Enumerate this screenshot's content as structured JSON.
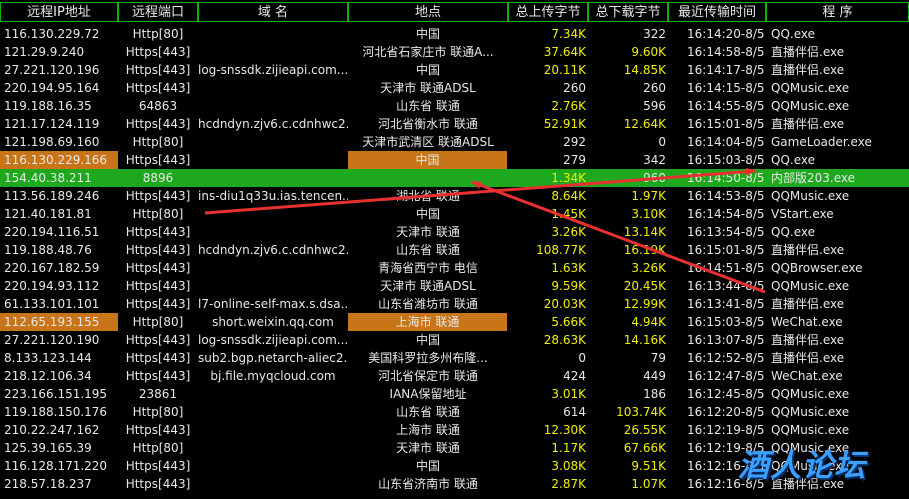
{
  "headers": {
    "ip": "远程IP地址",
    "port": "远程端口",
    "domain": "域  名",
    "location": "地点",
    "upload": "总上传字节",
    "download": "总下载字节",
    "time": "最近传输时间",
    "program": "程  序"
  },
  "colors": {
    "text_default": "#e8e8e8",
    "up_down_normal": "#e8e8e8",
    "up_down_active": "#f0f000",
    "header_border": "#00b400",
    "row_highlight": "#c87418",
    "row_selected": "#1da81d",
    "annotation_arrow": "#e83030",
    "watermark": "#3aa0ff"
  },
  "rows": [
    {
      "ip": "116.130.229.72",
      "port": "Http[80]",
      "domain": "",
      "location": "中国",
      "up": "7.34K",
      "down": "322",
      "time": "16:14:20-8/5",
      "program": "QQ.exe",
      "up_active": true,
      "down_active": false
    },
    {
      "ip": "121.29.9.240",
      "port": "Https[443]",
      "domain": "",
      "location": "河北省石家庄市 联通A...",
      "up": "37.64K",
      "down": "9.60K",
      "time": "16:14:58-8/5",
      "program": "直播伴侣.exe",
      "up_active": true,
      "down_active": true
    },
    {
      "ip": "27.221.120.196",
      "port": "Https[443]",
      "domain": "log-snssdk.zijieapi.com....",
      "location": "中国",
      "up": "20.11K",
      "down": "14.85K",
      "time": "16:14:17-8/5",
      "program": "直播伴侣.exe",
      "up_active": true,
      "down_active": true
    },
    {
      "ip": "220.194.95.164",
      "port": "Https[443]",
      "domain": "",
      "location": "天津市 联通ADSL",
      "up": "260",
      "down": "260",
      "time": "16:14:15-8/5",
      "program": "QQMusic.exe",
      "up_active": false,
      "down_active": false
    },
    {
      "ip": "119.188.16.35",
      "port": "64863",
      "domain": "",
      "location": "山东省 联通",
      "up": "2.76K",
      "down": "596",
      "time": "16:14:55-8/5",
      "program": "QQMusic.exe",
      "up_active": true,
      "down_active": false
    },
    {
      "ip": "121.17.124.119",
      "port": "Https[443]",
      "domain": "hcdndyn.zjv6.c.cdnhwc2....",
      "location": "河北省衡水市 联通",
      "up": "52.91K",
      "down": "12.64K",
      "time": "16:15:01-8/5",
      "program": "直播伴侣.exe",
      "up_active": true,
      "down_active": true
    },
    {
      "ip": "121.198.69.160",
      "port": "Http[80]",
      "domain": "",
      "location": "天津市武清区 联通ADSL",
      "up": "292",
      "down": "0",
      "time": "16:14:04-8/5",
      "program": "GameLoader.exe",
      "up_active": false,
      "down_active": false
    },
    {
      "ip": "116.130.229.166",
      "port": "Https[443]",
      "domain": "",
      "location": "中国",
      "up": "279",
      "down": "342",
      "time": "16:15:03-8/5",
      "program": "QQ.exe",
      "up_active": false,
      "down_active": false,
      "hl_ip": true,
      "hl_loc": true
    },
    {
      "ip": "154.40.38.211",
      "port": "8896",
      "domain": "",
      "location": "",
      "up": "1.34K",
      "down": "960",
      "time": "16:14:50-8/5",
      "program": "内部版203.exe",
      "up_active": true,
      "down_active": false,
      "selected": true
    },
    {
      "ip": "113.56.189.246",
      "port": "Https[443]",
      "domain": "ins-diu1q33u.ias.tencen...",
      "location": "湖北省 联通",
      "up": "8.64K",
      "down": "1.97K",
      "time": "16:14:53-8/5",
      "program": "QQMusic.exe",
      "up_active": true,
      "down_active": true
    },
    {
      "ip": "121.40.181.81",
      "port": "Http[80]",
      "domain": "",
      "location": "中国",
      "up": "1.45K",
      "down": "3.10K",
      "time": "16:14:54-8/5",
      "program": "VStart.exe",
      "up_active": true,
      "down_active": true
    },
    {
      "ip": "220.194.116.51",
      "port": "Https[443]",
      "domain": "",
      "location": "天津市 联通",
      "up": "3.26K",
      "down": "13.14K",
      "time": "16:13:54-8/5",
      "program": "QQ.exe",
      "up_active": true,
      "down_active": true
    },
    {
      "ip": "119.188.48.76",
      "port": "Https[443]",
      "domain": "hcdndyn.zjv6.c.cdnhwc2....",
      "location": "山东省 联通",
      "up": "108.77K",
      "down": "16.19K",
      "time": "16:15:01-8/5",
      "program": "直播伴侣.exe",
      "up_active": true,
      "down_active": true
    },
    {
      "ip": "220.167.182.59",
      "port": "Https[443]",
      "domain": "",
      "location": "青海省西宁市 电信",
      "up": "1.63K",
      "down": "3.26K",
      "time": "16:14:51-8/5",
      "program": "QQBrowser.exe",
      "up_active": true,
      "down_active": true
    },
    {
      "ip": "220.194.93.112",
      "port": "Https[443]",
      "domain": "",
      "location": "天津市 联通ADSL",
      "up": "9.59K",
      "down": "20.45K",
      "time": "16:13:44-8/5",
      "program": "QQMusic.exe",
      "up_active": true,
      "down_active": true
    },
    {
      "ip": "61.133.101.101",
      "port": "Https[443]",
      "domain": "l7-online-self-max.s.dsa...",
      "location": "山东省潍坊市 联通",
      "up": "20.03K",
      "down": "12.99K",
      "time": "16:13:41-8/5",
      "program": "直播伴侣.exe",
      "up_active": true,
      "down_active": true
    },
    {
      "ip": "112.65.193.155",
      "port": "Http[80]",
      "domain": "short.weixin.qq.com",
      "location": "上海市 联通",
      "up": "5.66K",
      "down": "4.94K",
      "time": "16:15:03-8/5",
      "program": "WeChat.exe",
      "up_active": true,
      "down_active": true,
      "hl_ip": true,
      "hl_loc": true
    },
    {
      "ip": "27.221.120.190",
      "port": "Https[443]",
      "domain": "log-snssdk.zijieapi.com....",
      "location": "中国",
      "up": "28.63K",
      "down": "14.16K",
      "time": "16:13:07-8/5",
      "program": "直播伴侣.exe",
      "up_active": true,
      "down_active": true
    },
    {
      "ip": "8.133.123.144",
      "port": "Https[443]",
      "domain": "sub2.bgp.netarch-aliec2....",
      "location": "美国科罗拉多州布隆...",
      "up": "0",
      "down": "79",
      "time": "16:12:52-8/5",
      "program": "直播伴侣.exe",
      "up_active": false,
      "down_active": false
    },
    {
      "ip": "218.12.106.34",
      "port": "Https[443]",
      "domain": "bj.file.myqcloud.com",
      "location": "河北省保定市 联通",
      "up": "424",
      "down": "449",
      "time": "16:12:47-8/5",
      "program": "WeChat.exe",
      "up_active": false,
      "down_active": false
    },
    {
      "ip": "223.166.151.195",
      "port": "23861",
      "domain": "",
      "location": "IANA保留地址",
      "up": "3.01K",
      "down": "186",
      "time": "16:12:45-8/5",
      "program": "QQMusic.exe",
      "up_active": true,
      "down_active": false
    },
    {
      "ip": "119.188.150.176",
      "port": "Http[80]",
      "domain": "",
      "location": "山东省 联通",
      "up": "614",
      "down": "103.74K",
      "time": "16:12:20-8/5",
      "program": "QQMusic.exe",
      "up_active": false,
      "down_active": true
    },
    {
      "ip": "210.22.247.162",
      "port": "Https[443]",
      "domain": "",
      "location": "上海市 联通",
      "up": "12.30K",
      "down": "26.55K",
      "time": "16:12:19-8/5",
      "program": "QQMusic.exe",
      "up_active": true,
      "down_active": true
    },
    {
      "ip": "125.39.165.39",
      "port": "Http[80]",
      "domain": "",
      "location": "天津市 联通",
      "up": "1.17K",
      "down": "67.66K",
      "time": "16:12:19-8/5",
      "program": "QQMusic.exe",
      "up_active": true,
      "down_active": true
    },
    {
      "ip": "116.128.171.220",
      "port": "Https[443]",
      "domain": "",
      "location": "中国",
      "up": "3.08K",
      "down": "9.51K",
      "time": "16:12:16-8/5",
      "program": "QQMusic.exe",
      "up_active": true,
      "down_active": true
    },
    {
      "ip": "218.57.18.237",
      "port": "Https[443]",
      "domain": "",
      "location": "山东省济南市 联通",
      "up": "2.87K",
      "down": "1.07K",
      "time": "16:12:16-8/5",
      "program": "直播伴侣.exe",
      "up_active": true,
      "down_active": true
    }
  ],
  "watermark": "酒人论坛"
}
